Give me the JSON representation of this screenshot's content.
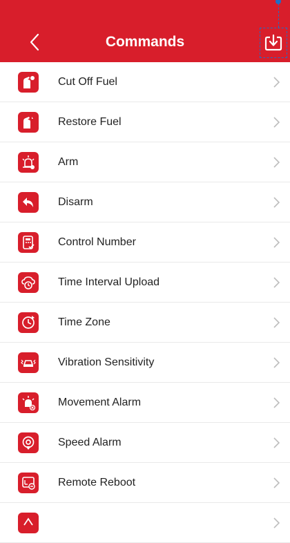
{
  "header": {
    "title": "Commands",
    "back_icon": "chevron-left-icon",
    "download_icon": "download-icon"
  },
  "colors": {
    "brand": "#d81e2b",
    "annotation": "#1f6fc7"
  },
  "commands": [
    {
      "label": "Cut Off Fuel",
      "icon": "fuel-cut-icon"
    },
    {
      "label": "Restore Fuel",
      "icon": "fuel-restore-icon"
    },
    {
      "label": "Arm",
      "icon": "siren-arm-icon"
    },
    {
      "label": "Disarm",
      "icon": "undo-disarm-icon"
    },
    {
      "label": "Control Number",
      "icon": "control-number-icon"
    },
    {
      "label": "Time Interval Upload",
      "icon": "time-upload-icon"
    },
    {
      "label": "Time Zone",
      "icon": "clock-icon"
    },
    {
      "label": "Vibration Sensitivity",
      "icon": "vibration-car-icon"
    },
    {
      "label": "Movement Alarm",
      "icon": "movement-alarm-icon"
    },
    {
      "label": "Speed Alarm",
      "icon": "speed-pin-icon"
    },
    {
      "label": "Remote Reboot",
      "icon": "remote-reboot-icon"
    },
    {
      "label": "",
      "icon": "partial-icon"
    }
  ]
}
